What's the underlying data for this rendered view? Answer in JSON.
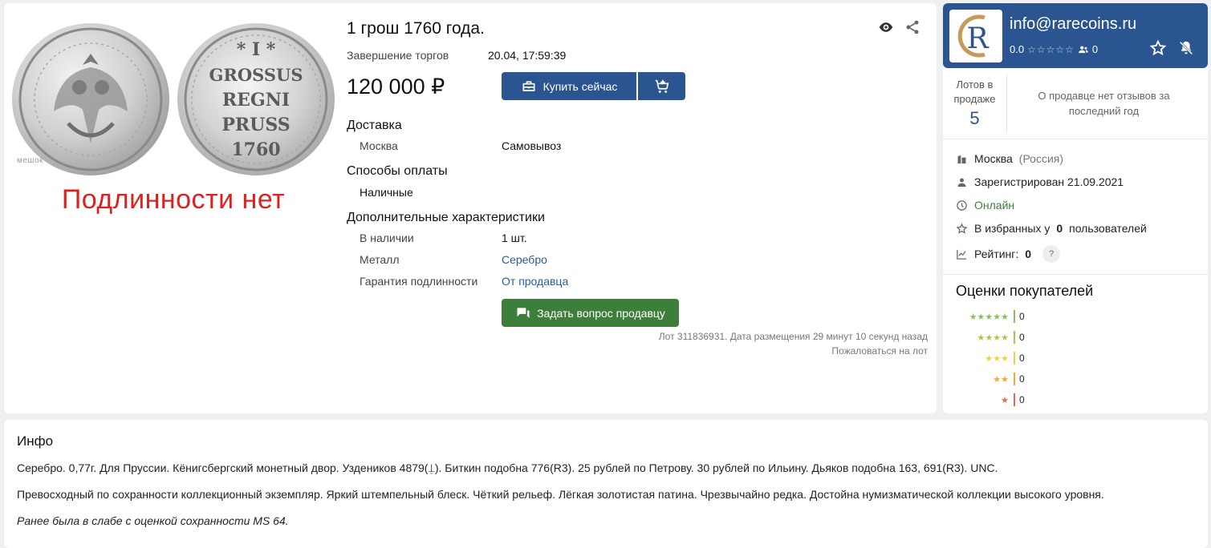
{
  "lot": {
    "title": "1 грош 1760 года.",
    "watermark": "мешок",
    "authenticity_note": "Подлинности нет",
    "auction_end_label": "Завершение торгов",
    "auction_end_value": "20.04, 17:59:39",
    "price": "120 000 ₽",
    "buy_now_label": "Купить сейчас",
    "delivery": {
      "title": "Доставка",
      "city": "Москва",
      "method": "Самовывоз"
    },
    "payment": {
      "title": "Способы оплаты",
      "method": "Наличные"
    },
    "characteristics": {
      "title": "Дополнительные характеристики",
      "rows": [
        {
          "label": "В наличии",
          "value": "1 шт."
        },
        {
          "label": "Металл",
          "value": "Серебро"
        },
        {
          "label": "Гарантия подлинности",
          "value": "От продавца"
        }
      ]
    },
    "ask_seller_label": "Задать вопрос продавцу",
    "lot_meta": "Лот 311836931. Дата размещения 29 минут 10 секунд назад",
    "complain_label": "Пожаловаться на лот"
  },
  "seller": {
    "name": "info@rarecoins.ru",
    "rating": "0.0",
    "rating_stars": "☆☆☆☆☆",
    "followers": "0",
    "lots_label": "Лотов в продаже",
    "lots_count": "5",
    "reviews_note": "О продавце нет отзывов за последний год",
    "city": "Москва",
    "country": "(Россия)",
    "registered": "Зарегистрирован 21.09.2021",
    "status": "Онлайн",
    "favorites_prefix": "В избранных у",
    "favorites_count": "0",
    "favorites_suffix": "пользователей",
    "rating_label": "Рейтинг:",
    "rating_value": "0",
    "rating_help": "?",
    "colors": {
      "header": "#2b5590",
      "online": "#3d7f3a"
    }
  },
  "buyer_ratings": {
    "title": "Оценки покупателей",
    "rows": [
      {
        "stars": "★★★★★",
        "count": "0",
        "color": "#8bbf5a"
      },
      {
        "stars": "★★★★",
        "count": "0",
        "color": "#a7c94a"
      },
      {
        "stars": "★★★",
        "count": "0",
        "color": "#f2cf45"
      },
      {
        "stars": "★★",
        "count": "0",
        "color": "#f0a83a"
      },
      {
        "stars": "★",
        "count": "0",
        "color": "#e8694a"
      }
    ]
  },
  "info": {
    "title": "Инфо",
    "paragraph1": "Серебро. 0,77г. Для Пруссии. Кёнигсбергский монетный двор. Уздеников 4879(⍊). Биткин подобна 776(R3). 25 рублей по Петрову. 30 рублей по Ильину. Дьяков подобна 163, 691(R3). UNC.",
    "paragraph2": "Превосходный по сохранности коллекционный экземпляр. Яркий штемпельный блеск. Чёткий рельеф. Лёгкая золотистая патина. Чрезвычайно редка. Достойна нумизматической коллекции высокого уровня.",
    "note": "Ранее была в слабе с оценкой сохранности MS 64."
  }
}
